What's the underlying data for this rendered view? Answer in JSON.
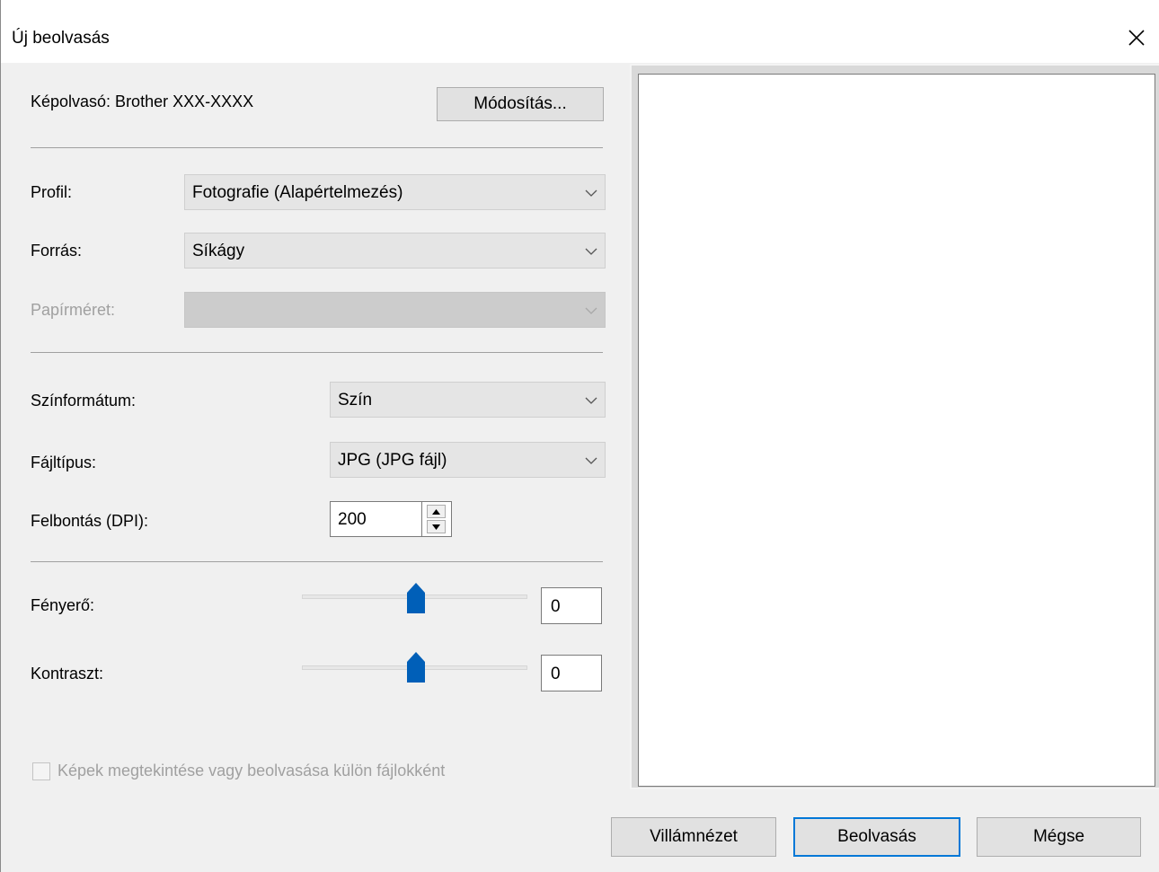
{
  "window": {
    "title": "Új beolvasás"
  },
  "scanner": {
    "label": "Képolvasó: Brother XXX-XXXX",
    "change_button": "Módosítás..."
  },
  "profile": {
    "label": "Profil:",
    "value": "Fotografie (Alapértelmezés)"
  },
  "source": {
    "label": "Forrás:",
    "value": "Síkágy"
  },
  "paper_size": {
    "label": "Papírméret:",
    "value": "",
    "enabled": false
  },
  "color_format": {
    "label": "Színformátum:",
    "value": "Szín"
  },
  "file_type": {
    "label": "Fájltípus:",
    "value": "JPG (JPG fájl)"
  },
  "resolution": {
    "label": "Felbontás (DPI):",
    "value": "200"
  },
  "brightness": {
    "label": "Fényerő:",
    "value": "0",
    "slider_position": 0.5
  },
  "contrast": {
    "label": "Kontraszt:",
    "value": "0",
    "slider_position": 0.5
  },
  "separate_files": {
    "label": "Képek megtekintése vagy beolvasása külön fájlokként",
    "checked": false,
    "enabled": false
  },
  "buttons": {
    "preview": "Villámnézet",
    "scan": "Beolvasás",
    "cancel": "Mégse"
  },
  "icons": {
    "close": "close-icon",
    "dropdown": "chevron-down-icon",
    "spin_up": "arrow-up-icon",
    "spin_down": "arrow-down-icon"
  },
  "colors": {
    "accent": "#005fb8",
    "default_button_border": "#0078d7"
  }
}
